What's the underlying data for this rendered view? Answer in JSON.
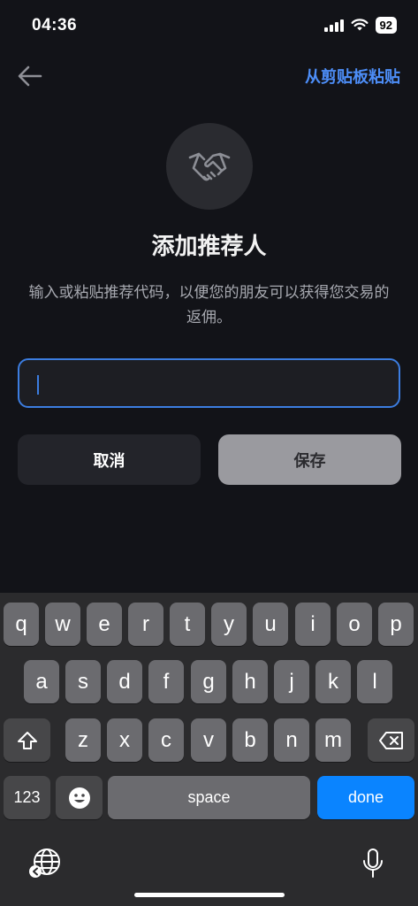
{
  "status": {
    "time": "04:36",
    "battery": "92"
  },
  "header": {
    "paste_label": "从剪贴板粘贴"
  },
  "title": "添加推荐人",
  "description": "输入或粘贴推荐代码，以便您的朋友可以获得您交易的返佣。",
  "input": {
    "value": "",
    "placeholder": ""
  },
  "buttons": {
    "cancel": "取消",
    "save": "保存"
  },
  "keyboard": {
    "row1": [
      "q",
      "w",
      "e",
      "r",
      "t",
      "y",
      "u",
      "i",
      "o",
      "p"
    ],
    "row2": [
      "a",
      "s",
      "d",
      "f",
      "g",
      "h",
      "j",
      "k",
      "l"
    ],
    "row3": [
      "z",
      "x",
      "c",
      "v",
      "b",
      "n",
      "m"
    ],
    "numbers_label": "123",
    "space_label": "space",
    "done_label": "done"
  },
  "colors": {
    "accent": "#3c7de0",
    "link": "#4d8ef8",
    "background": "#121318",
    "done_key": "#0a84ff"
  }
}
